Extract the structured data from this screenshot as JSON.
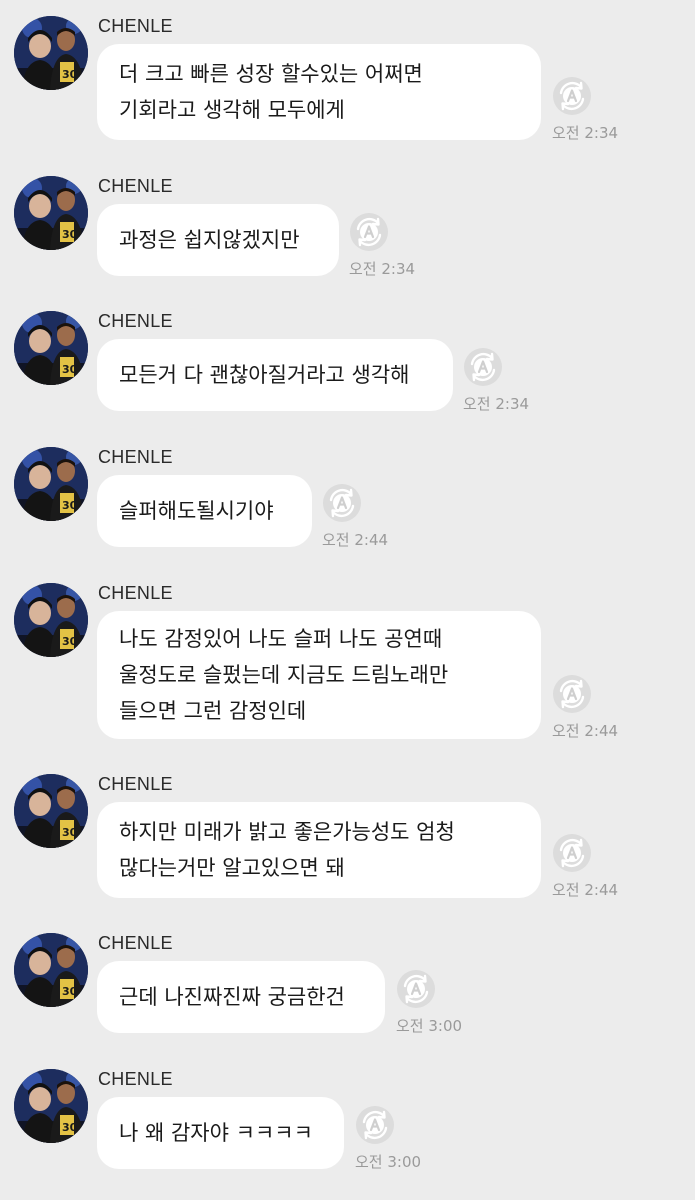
{
  "messages": [
    {
      "sender": "CHENLE",
      "lines": [
        "더 크고 빠른 성장 할수있는 어쩌면",
        "기회라고 생각해 모두에게"
      ],
      "time": "오전 2:34"
    },
    {
      "sender": "CHENLE",
      "lines": [
        "과정은 쉽지않겠지만"
      ],
      "time": "오전 2:34"
    },
    {
      "sender": "CHENLE",
      "lines": [
        "모든거 다 괜찮아질거라고 생각해"
      ],
      "time": "오전 2:34"
    },
    {
      "sender": "CHENLE",
      "lines": [
        "슬퍼해도될시기야"
      ],
      "time": "오전 2:44"
    },
    {
      "sender": "CHENLE",
      "lines": [
        "나도 감정있어 나도 슬퍼 나도 공연때",
        "울정도로 슬펐는데 지금도 드림노래만",
        "들으면 그런 감정인데"
      ],
      "time": "오전 2:44"
    },
    {
      "sender": "CHENLE",
      "lines": [
        "하지만 미래가 밝고 좋은가능성도 엄청",
        "많다는거만 알고있으면 돼"
      ],
      "time": "오전 2:44"
    },
    {
      "sender": "CHENLE",
      "lines": [
        "근데 나진짜진짜 궁금한건"
      ],
      "time": "오전 3:00"
    },
    {
      "sender": "CHENLE",
      "lines": [
        "나 왜 감자야 ㅋㅋㅋㅋ"
      ],
      "time": "오전 3:00"
    }
  ],
  "icons": {
    "avatar": "profile-photo-avatar",
    "read_status": "translate-a-icon"
  },
  "colors": {
    "background": "#ececec",
    "bubble": "#ffffff",
    "timestamp": "#9a9a9a"
  }
}
